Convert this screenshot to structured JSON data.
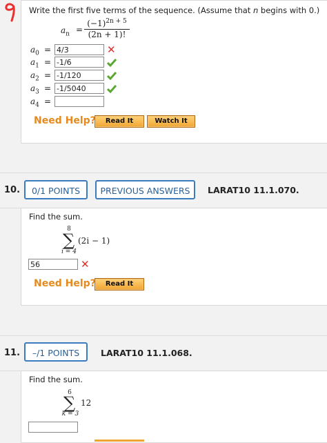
{
  "q9": {
    "number_mark": "9",
    "prompt_a": "Write the first five terms of the sequence. (Assume that ",
    "prompt_n": "n",
    "prompt_b": " begins with 0.)",
    "formula": {
      "lhs": "a",
      "lhs_sub": "n",
      "equals": "=",
      "num": "(−1)",
      "num_exp": "2n + 5",
      "den": "(2n + 1)!"
    },
    "terms": [
      {
        "label": "a",
        "sub": "0",
        "value": "4/3",
        "status": "incorrect"
      },
      {
        "label": "a",
        "sub": "1",
        "value": "-1/6",
        "status": "correct"
      },
      {
        "label": "a",
        "sub": "2",
        "value": "-1/120",
        "status": "correct"
      },
      {
        "label": "a",
        "sub": "3",
        "value": "-1/5040",
        "status": "correct"
      },
      {
        "label": "a",
        "sub": "4",
        "value": "",
        "status": "none"
      }
    ],
    "need_help": "Need Help?",
    "read_it": "Read It",
    "watch_it": "Watch It"
  },
  "q10": {
    "number": "10.",
    "points": "0/1 POINTS",
    "previous_answers": "PREVIOUS ANSWERS",
    "ref": "LARAT10 11.1.070.",
    "prompt": "Find the sum.",
    "sum_upper": "8",
    "sum_lower": "i = 4",
    "sum_expr": "(2i − 1)",
    "answer": "56",
    "status": "incorrect",
    "need_help": "Need Help?",
    "read_it": "Read It"
  },
  "q11": {
    "number": "11.",
    "points": "–/1 POINTS",
    "ref": "LARAT10 11.1.068.",
    "prompt": "Find the sum.",
    "sum_upper": "6",
    "sum_lower": "k = 3",
    "sum_expr": "12",
    "answer": ""
  },
  "colors": {
    "accent_blue": "#3a7bbf",
    "help_orange": "#e58a1f",
    "incorrect_red": "#d9302e",
    "correct_green": "#5aa832",
    "annotation_red": "#e8312f"
  }
}
